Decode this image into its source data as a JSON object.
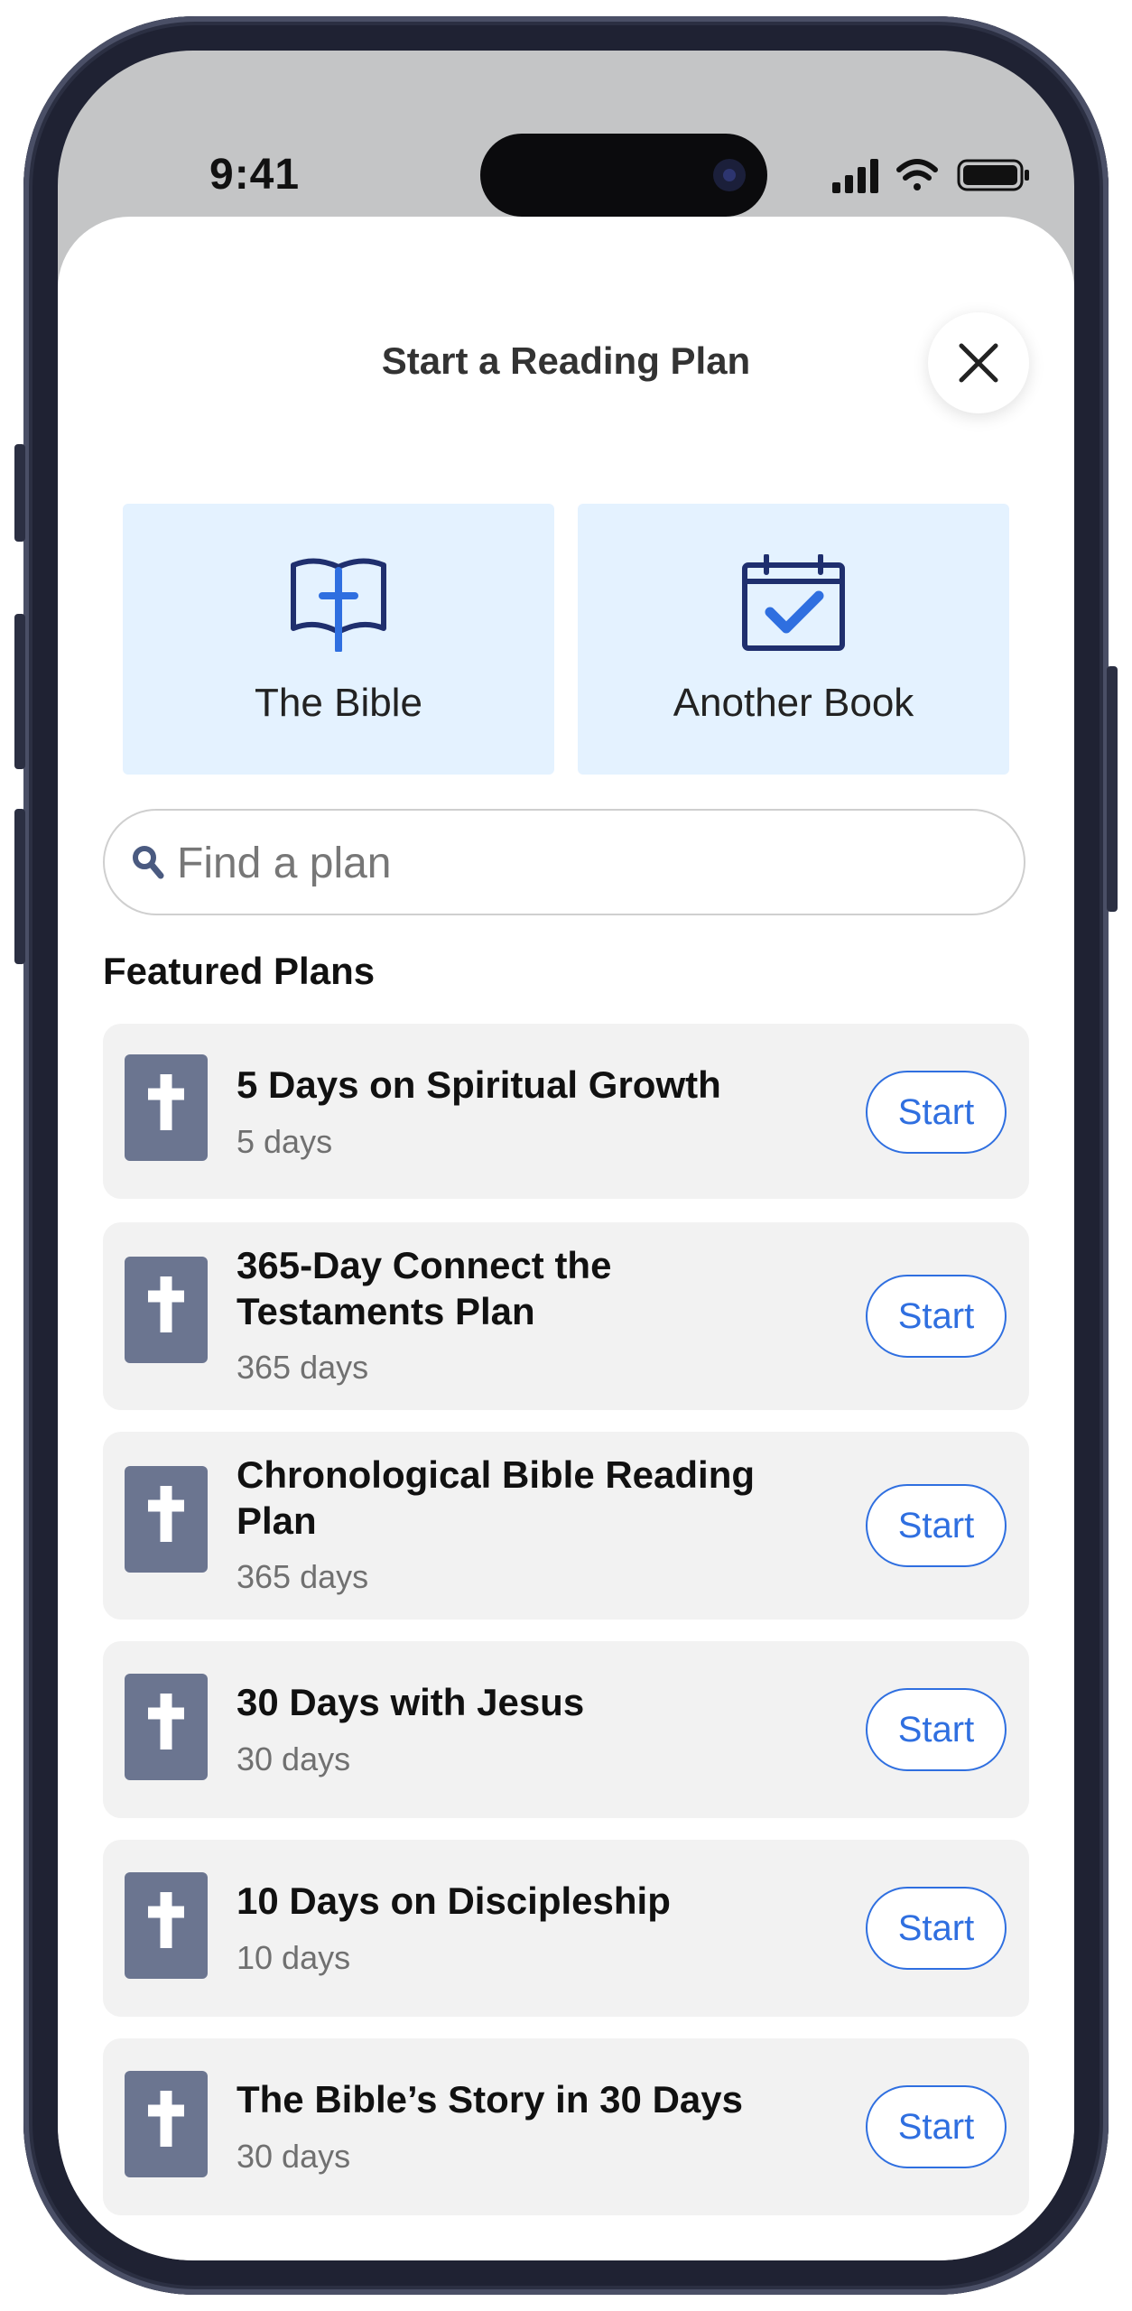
{
  "status_bar": {
    "time": "9:41"
  },
  "sheet": {
    "title": "Start a Reading Plan"
  },
  "options": [
    {
      "label": "The Bible",
      "icon": "open-bible-icon"
    },
    {
      "label": "Another Book",
      "icon": "calendar-check-icon"
    }
  ],
  "search": {
    "placeholder": "Find a plan"
  },
  "featured": {
    "heading": "Featured Plans",
    "plans": [
      {
        "title": "5 Days on Spiritual Growth",
        "days": "5 days",
        "action": "Start"
      },
      {
        "title": "365-Day Connect the Testaments Plan",
        "days": "365 days",
        "action": "Start"
      },
      {
        "title": "Chronological Bible Reading Plan",
        "days": "365 days",
        "action": "Start"
      },
      {
        "title": "30 Days with Jesus",
        "days": "30 days",
        "action": "Start"
      },
      {
        "title": "10 Days on Discipleship",
        "days": "10 days",
        "action": "Start"
      },
      {
        "title": "The Bible’s Story in 30 Days",
        "days": "30 days",
        "action": "Start"
      }
    ]
  },
  "colors": {
    "accent": "#2f6fe0",
    "option_bg": "#e4f2ff",
    "card_bg": "#f2f2f2",
    "plan_icon": "#6b7590"
  }
}
